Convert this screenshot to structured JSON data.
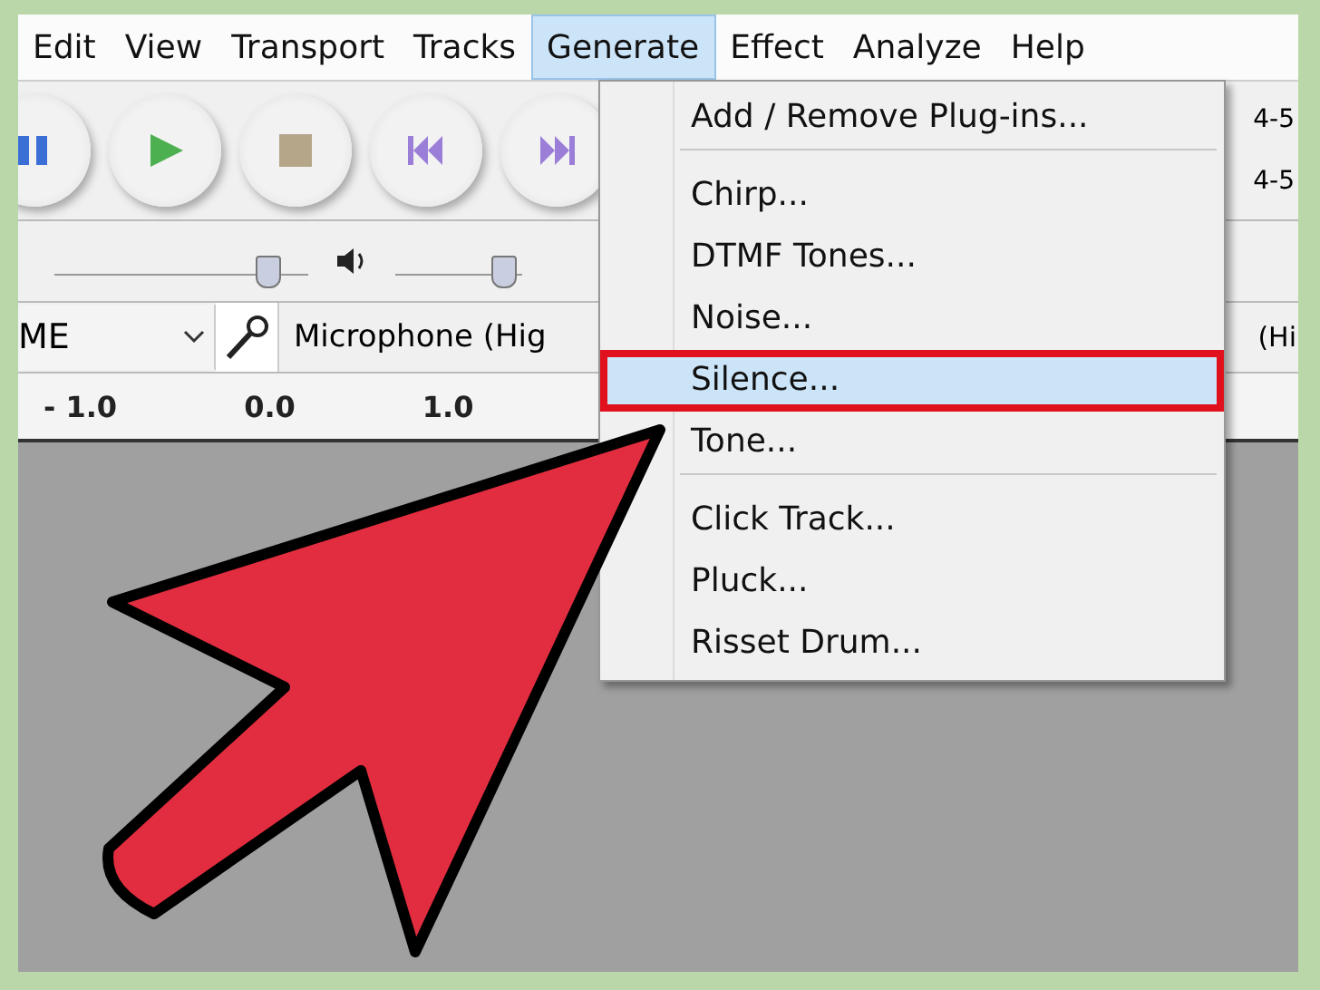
{
  "menu_bar": [
    {
      "label": "Edit",
      "selected": false
    },
    {
      "label": "View",
      "selected": false
    },
    {
      "label": "Transport",
      "selected": false
    },
    {
      "label": "Tracks",
      "selected": false
    },
    {
      "label": "Generate",
      "selected": true
    },
    {
      "label": "Effect",
      "selected": false
    },
    {
      "label": "Analyze",
      "selected": false
    },
    {
      "label": "Help",
      "selected": false
    }
  ],
  "sliders": [
    {
      "kind": "gain",
      "level": 0.88
    },
    {
      "kind": "volume",
      "level": 0.95
    }
  ],
  "transport_buttons": [
    {
      "kind": "pause"
    },
    {
      "kind": "play"
    },
    {
      "kind": "stop"
    },
    {
      "kind": "skip-start"
    },
    {
      "kind": "skip-end"
    }
  ],
  "meter_fragments": [
    "4-5",
    "4-5"
  ],
  "device_bar": {
    "host": "ME",
    "input": "Microphone (Hig",
    "input_right": "(Hi"
  },
  "ruler": [
    "- 1.0",
    "0.0",
    "1.0"
  ],
  "dropdown": [
    {
      "label": "Add / Remove Plug-ins...",
      "selected": false,
      "highlighted": false,
      "separator_after": true
    },
    {
      "label": "Chirp...",
      "selected": false,
      "highlighted": false,
      "separator_after": false
    },
    {
      "label": "DTMF Tones...",
      "selected": false,
      "highlighted": false,
      "separator_after": false
    },
    {
      "label": "Noise...",
      "selected": false,
      "highlighted": false,
      "separator_after": false
    },
    {
      "label": "Silence...",
      "selected": true,
      "highlighted": true,
      "separator_after": false
    },
    {
      "label": "Tone...",
      "selected": false,
      "highlighted": false,
      "separator_after": true
    },
    {
      "label": "Click Track...",
      "selected": false,
      "highlighted": false,
      "separator_after": false
    },
    {
      "label": "Pluck...",
      "selected": false,
      "highlighted": false,
      "separator_after": false
    },
    {
      "label": "Risset Drum...",
      "selected": false,
      "highlighted": false,
      "separator_after": false
    }
  ]
}
